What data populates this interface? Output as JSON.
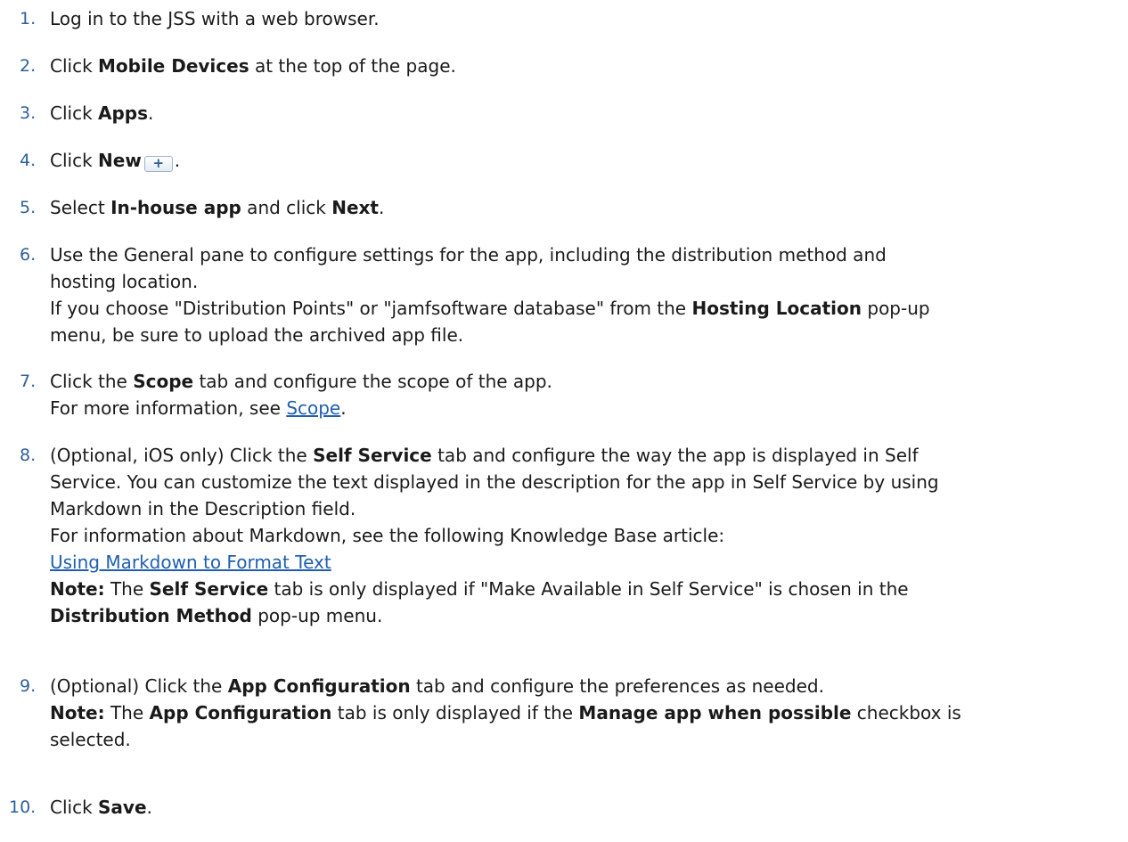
{
  "steps": [
    {
      "num": "1.",
      "text": "Log in to the JSS with a web browser."
    },
    {
      "num": "2.",
      "pre": "Click ",
      "bold": "Mobile Devices",
      "post": " at the top of the page."
    },
    {
      "num": "3.",
      "pre": "Click ",
      "bold": "Apps",
      "post": "."
    },
    {
      "num": "4.",
      "pre": "Click ",
      "bold": "New",
      "icon": "+",
      "post": "."
    },
    {
      "num": "5.",
      "pre": "Select ",
      "bold1": "In-house app",
      "mid": " and click ",
      "bold2": "Next",
      "post": "."
    },
    {
      "num": "6.",
      "line1": "Use the General pane to configure settings for the app, including the distribution method and",
      "line2": "hosting location.",
      "line3_pre": "If you choose \"Distribution Points\" or \"jamfsoftware database\" from the ",
      "line3_bold": "Hosting Location",
      "line3_post": " pop-up",
      "line4": "menu, be sure to upload the archived app file."
    },
    {
      "num": "7.",
      "pre": "Click the ",
      "bold": "Scope",
      "post": " tab and configure the scope of the app.",
      "line2_pre": "For more information, see ",
      "line2_link": "Scope",
      "line2_post": "."
    },
    {
      "num": "8.",
      "line1_pre": "(Optional, iOS only) Click the ",
      "line1_bold": "Self Service",
      "line1_post": " tab and configure the way the app is displayed in Self",
      "line2": "Service. You can customize the text displayed in the description for the app in Self Service by using",
      "line3": "Markdown in the Description field.",
      "line4": "For information about Markdown, see the following Knowledge Base article:",
      "line5_link": "Using Markdown to Format Text",
      "line6_note": "Note:",
      "line6_mid": " The ",
      "line6_bold": "Self Service",
      "line6_post": " tab is only displayed if \"Make Available in Self Service\" is chosen in the",
      "line7_bold": "Distribution Method",
      "line7_post": " pop-up menu."
    },
    {
      "num": "9.",
      "line1_pre": "(Optional) Click the ",
      "line1_bold": "App Configuration",
      "line1_post": " tab and configure the preferences as needed.",
      "line2_note": "Note:",
      "line2_mid": " The ",
      "line2_bold": "App Configuration",
      "line2_mid2": " tab is only displayed if the ",
      "line2_bold2": "Manage app when possible",
      "line2_post": " checkbox is",
      "line3": "selected."
    },
    {
      "num": "10.",
      "pre": "Click ",
      "bold": "Save",
      "post": "."
    }
  ]
}
